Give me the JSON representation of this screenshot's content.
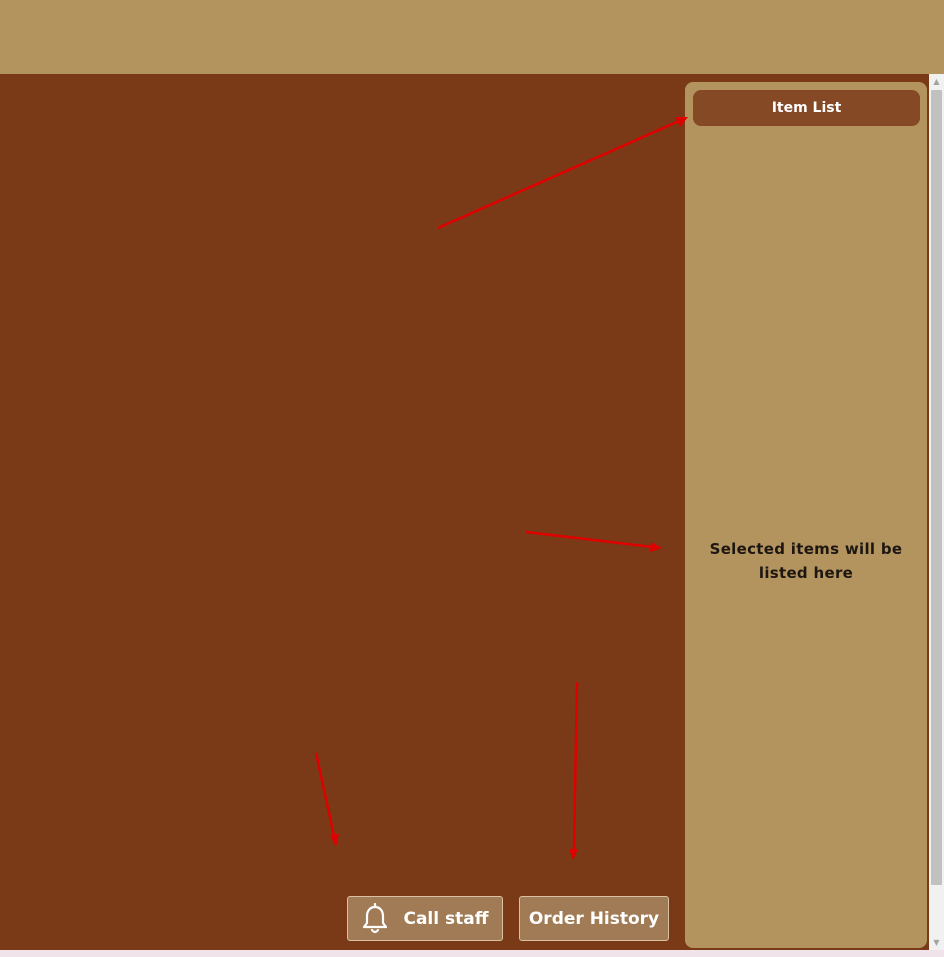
{
  "side_panel": {
    "header_label": "Item List",
    "empty_message": "Selected items will be listed here"
  },
  "actions": {
    "call_staff_label": "Call staff",
    "order_history_label": "Order History"
  },
  "icons": {
    "call_staff": "bell-icon"
  },
  "colors": {
    "top_bar": "#b3945e",
    "main_background": "#7a3a17",
    "side_panel": "#b3945e",
    "header_button": "#854925",
    "action_button": "#a07b55",
    "annotation_arrow": "#e00000"
  }
}
